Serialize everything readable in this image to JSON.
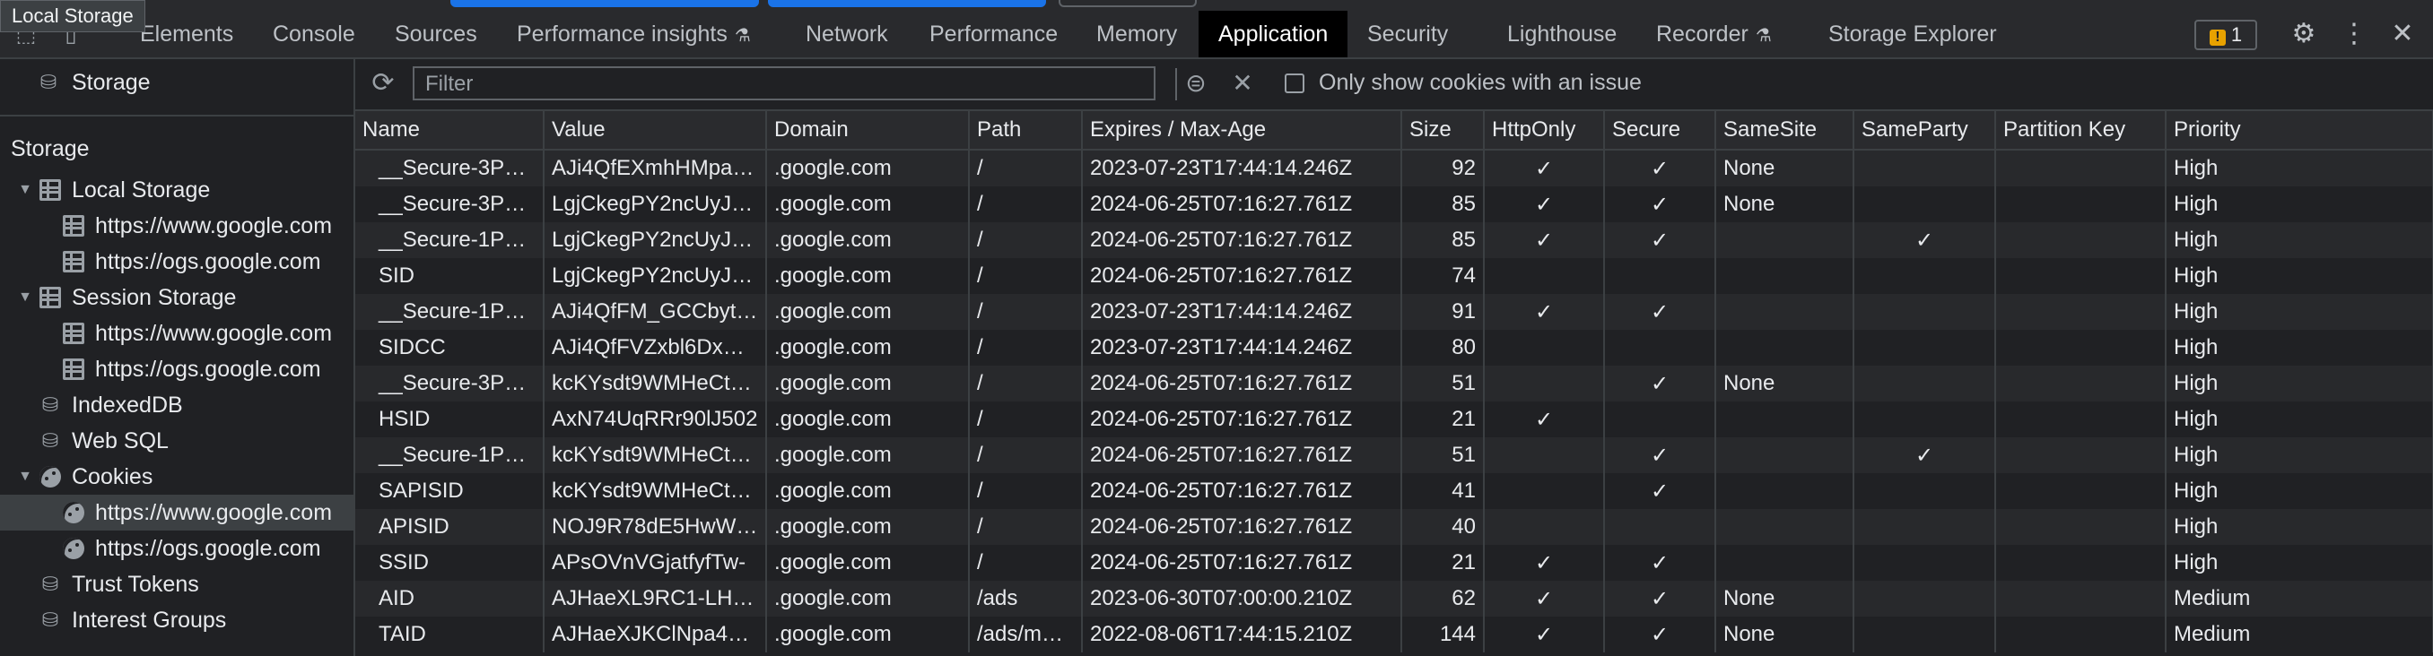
{
  "tooltip": "Local Storage",
  "tabs": [
    {
      "label": "Elements"
    },
    {
      "label": "Console"
    },
    {
      "label": "Sources"
    },
    {
      "label": "Performance insights"
    },
    {
      "label": "Network"
    },
    {
      "label": "Performance"
    },
    {
      "label": "Memory"
    },
    {
      "label": "Application"
    },
    {
      "label": "Security"
    },
    {
      "label": "Lighthouse"
    },
    {
      "label": "Recorder"
    },
    {
      "label": "Storage Explorer"
    }
  ],
  "active_tab": "Application",
  "issues_count": "1",
  "sidebar": {
    "top_item": "Storage",
    "section_title": "Storage",
    "local_storage": "Local Storage",
    "local_storage_origins": [
      "https://www.google.com",
      "https://ogs.google.com"
    ],
    "session_storage": "Session Storage",
    "session_storage_origins": [
      "https://www.google.com",
      "https://ogs.google.com"
    ],
    "indexeddb": "IndexedDB",
    "websql": "Web SQL",
    "cookies": "Cookies",
    "cookie_origins": [
      "https://www.google.com",
      "https://ogs.google.com"
    ],
    "trust_tokens": "Trust Tokens",
    "interest_groups": "Interest Groups"
  },
  "toolbar": {
    "filter_placeholder": "Filter",
    "only_issue_label": "Only show cookies with an issue"
  },
  "table": {
    "columns": [
      "Name",
      "Value",
      "Domain",
      "Path",
      "Expires / Max-Age",
      "Size",
      "HttpOnly",
      "Secure",
      "SameSite",
      "SameParty",
      "Partition Key",
      "Priority"
    ],
    "rows": [
      {
        "name": "__Secure-3P…",
        "value": "AJi4QfEXmhHMpa…",
        "domain": ".google.com",
        "path": "/",
        "expires": "2023-07-23T17:44:14.246Z",
        "size": "92",
        "httponly": "✓",
        "secure": "✓",
        "samesite": "None",
        "sameparty": "",
        "partition": "",
        "priority": "High"
      },
      {
        "name": "__Secure-3P…",
        "value": "LgjCkegPY2ncUyJ…",
        "domain": ".google.com",
        "path": "/",
        "expires": "2024-06-25T07:16:27.761Z",
        "size": "85",
        "httponly": "✓",
        "secure": "✓",
        "samesite": "None",
        "sameparty": "",
        "partition": "",
        "priority": "High"
      },
      {
        "name": "__Secure-1P…",
        "value": "LgjCkegPY2ncUyJ…",
        "domain": ".google.com",
        "path": "/",
        "expires": "2024-06-25T07:16:27.761Z",
        "size": "85",
        "httponly": "✓",
        "secure": "✓",
        "samesite": "",
        "sameparty": "✓",
        "partition": "",
        "priority": "High"
      },
      {
        "name": "SID",
        "value": "LgjCkegPY2ncUyJ…",
        "domain": ".google.com",
        "path": "/",
        "expires": "2024-06-25T07:16:27.761Z",
        "size": "74",
        "httponly": "",
        "secure": "",
        "samesite": "",
        "sameparty": "",
        "partition": "",
        "priority": "High"
      },
      {
        "name": "__Secure-1P…",
        "value": "AJi4QfFM_GCCbyt…",
        "domain": ".google.com",
        "path": "/",
        "expires": "2023-07-23T17:44:14.246Z",
        "size": "91",
        "httponly": "✓",
        "secure": "✓",
        "samesite": "",
        "sameparty": "",
        "partition": "",
        "priority": "High"
      },
      {
        "name": "SIDCC",
        "value": "AJi4QfFVZxbl6Dx…",
        "domain": ".google.com",
        "path": "/",
        "expires": "2023-07-23T17:44:14.246Z",
        "size": "80",
        "httponly": "",
        "secure": "",
        "samesite": "",
        "sameparty": "",
        "partition": "",
        "priority": "High"
      },
      {
        "name": "__Secure-3P…",
        "value": "kcKYsdt9WMHeCt…",
        "domain": ".google.com",
        "path": "/",
        "expires": "2024-06-25T07:16:27.761Z",
        "size": "51",
        "httponly": "",
        "secure": "✓",
        "samesite": "None",
        "sameparty": "",
        "partition": "",
        "priority": "High"
      },
      {
        "name": "HSID",
        "value": "AxN74UqRRr90lJ502",
        "domain": ".google.com",
        "path": "/",
        "expires": "2024-06-25T07:16:27.761Z",
        "size": "21",
        "httponly": "✓",
        "secure": "",
        "samesite": "",
        "sameparty": "",
        "partition": "",
        "priority": "High"
      },
      {
        "name": "__Secure-1P…",
        "value": "kcKYsdt9WMHeCt…",
        "domain": ".google.com",
        "path": "/",
        "expires": "2024-06-25T07:16:27.761Z",
        "size": "51",
        "httponly": "",
        "secure": "✓",
        "samesite": "",
        "sameparty": "✓",
        "partition": "",
        "priority": "High"
      },
      {
        "name": "SAPISID",
        "value": "kcKYsdt9WMHeCt…",
        "domain": ".google.com",
        "path": "/",
        "expires": "2024-06-25T07:16:27.761Z",
        "size": "41",
        "httponly": "",
        "secure": "✓",
        "samesite": "",
        "sameparty": "",
        "partition": "",
        "priority": "High"
      },
      {
        "name": "APISID",
        "value": "NOJ9R78dE5HwW…",
        "domain": ".google.com",
        "path": "/",
        "expires": "2024-06-25T07:16:27.761Z",
        "size": "40",
        "httponly": "",
        "secure": "",
        "samesite": "",
        "sameparty": "",
        "partition": "",
        "priority": "High"
      },
      {
        "name": "SSID",
        "value": "APsOVnVGjatfyfTw-",
        "domain": ".google.com",
        "path": "/",
        "expires": "2024-06-25T07:16:27.761Z",
        "size": "21",
        "httponly": "✓",
        "secure": "✓",
        "samesite": "",
        "sameparty": "",
        "partition": "",
        "priority": "High"
      },
      {
        "name": "AID",
        "value": "AJHaeXL9RC1-LH…",
        "domain": ".google.com",
        "path": "/ads",
        "expires": "2023-06-30T07:00:00.210Z",
        "size": "62",
        "httponly": "✓",
        "secure": "✓",
        "samesite": "None",
        "sameparty": "",
        "partition": "",
        "priority": "Medium"
      },
      {
        "name": "TAID",
        "value": "AJHaeXJKClNpa4…",
        "domain": ".google.com",
        "path": "/ads/m…",
        "expires": "2022-08-06T17:44:15.210Z",
        "size": "144",
        "httponly": "✓",
        "secure": "✓",
        "samesite": "None",
        "sameparty": "",
        "partition": "",
        "priority": "Medium"
      }
    ]
  },
  "colors": {
    "background": "#202124",
    "accent": "#1a73e8",
    "warning_badge": "#e8a200"
  }
}
